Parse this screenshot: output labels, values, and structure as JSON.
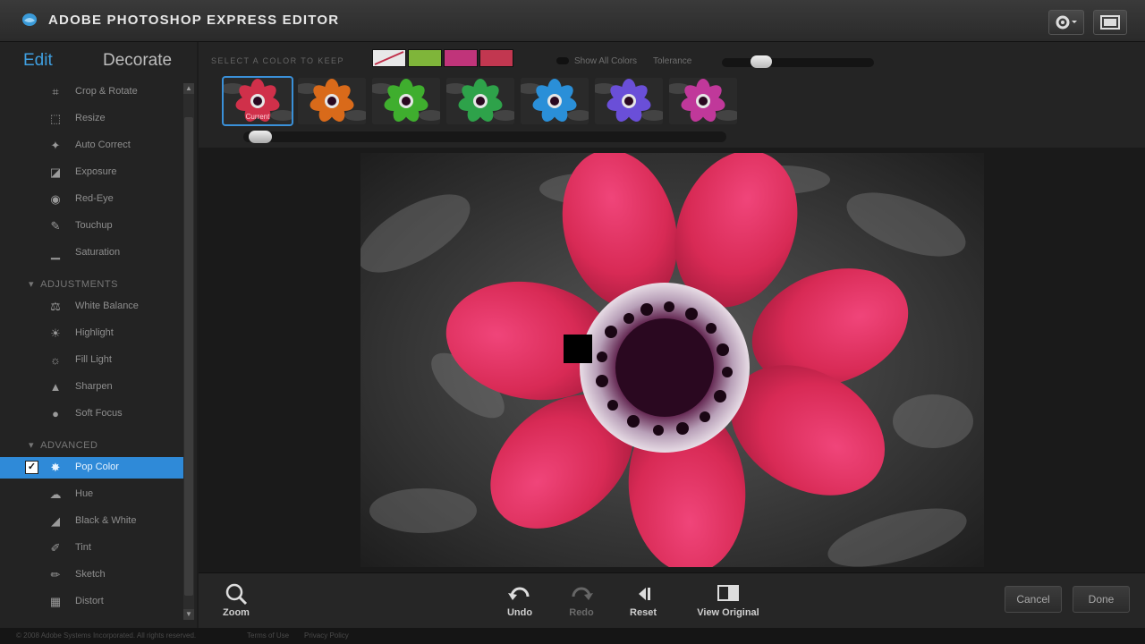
{
  "app": {
    "title": "ADOBE PHOTOSHOP EXPRESS EDITOR"
  },
  "sidebar": {
    "tabs": {
      "edit": "Edit",
      "decorate": "Decorate"
    },
    "basics": [
      {
        "label": "Crop & Rotate",
        "icon": "crop-icon"
      },
      {
        "label": "Resize",
        "icon": "resize-icon"
      },
      {
        "label": "Auto Correct",
        "icon": "wand-icon"
      },
      {
        "label": "Exposure",
        "icon": "exposure-icon"
      },
      {
        "label": "Red-Eye",
        "icon": "eye-icon"
      },
      {
        "label": "Touchup",
        "icon": "brush-icon"
      },
      {
        "label": "Saturation",
        "icon": "saturation-icon"
      }
    ],
    "adjustments_header": "ADJUSTMENTS",
    "adjustments": [
      {
        "label": "White Balance",
        "icon": "balance-icon"
      },
      {
        "label": "Highlight",
        "icon": "bulb-icon"
      },
      {
        "label": "Fill Light",
        "icon": "fill-light-icon"
      },
      {
        "label": "Sharpen",
        "icon": "sharpen-icon"
      },
      {
        "label": "Soft Focus",
        "icon": "drop-icon"
      }
    ],
    "advanced_header": "ADVANCED",
    "advanced": [
      {
        "label": "Pop Color",
        "icon": "pop-color-icon",
        "active": true
      },
      {
        "label": "Hue",
        "icon": "hue-icon"
      },
      {
        "label": "Black & White",
        "icon": "bw-icon"
      },
      {
        "label": "Tint",
        "icon": "tint-icon"
      },
      {
        "label": "Sketch",
        "icon": "pencil-icon"
      },
      {
        "label": "Distort",
        "icon": "distort-icon"
      }
    ]
  },
  "options": {
    "label": "SELECT A COLOR TO KEEP",
    "swatches": [
      "#e8e8e8",
      "#7fb53a",
      "#c0347a",
      "#c23750"
    ],
    "toggle_label": "Show All Colors",
    "tolerance_label": "Tolerance",
    "tolerance_value": 0.22,
    "thumb_scroll": 0.0,
    "thumbnails": [
      {
        "name": "red",
        "color": "#d0304a",
        "selected": true,
        "caption": "Current"
      },
      {
        "name": "orange",
        "color": "#d96a1a"
      },
      {
        "name": "green",
        "color": "#3fae2e"
      },
      {
        "name": "green-2",
        "color": "#2ea24a"
      },
      {
        "name": "blue",
        "color": "#2a8fd8"
      },
      {
        "name": "purple",
        "color": "#6a4fd8"
      },
      {
        "name": "magenta",
        "color": "#c0389a"
      }
    ]
  },
  "toolbar": {
    "zoom": "Zoom",
    "undo": "Undo",
    "redo": "Redo",
    "reset": "Reset",
    "view_original": "View Original",
    "cancel": "Cancel",
    "done": "Done"
  },
  "footer": {
    "copyright": "© 2008 Adobe Systems Incorporated. All rights reserved.",
    "terms": "Terms of Use",
    "privacy": "Privacy Policy"
  },
  "colors": {
    "accent": "#2f8ad8",
    "flower": "#e0325a"
  }
}
